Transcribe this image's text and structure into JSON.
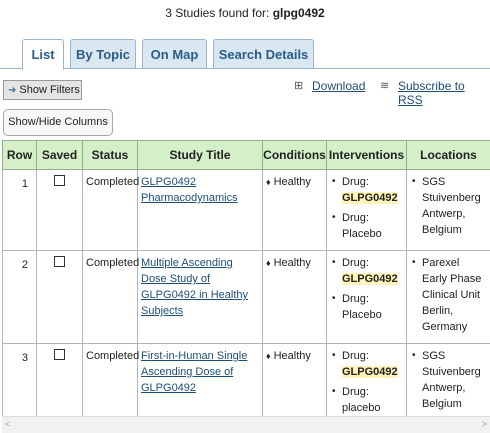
{
  "header": {
    "prefix": "3 Studies found for: ",
    "query": "glpg0492"
  },
  "tabs": [
    {
      "label": "List"
    },
    {
      "label": "By Topic"
    },
    {
      "label": "On Map"
    },
    {
      "label": "Search Details"
    }
  ],
  "toolbar": {
    "show_filters": "Show Filters",
    "download": "Download",
    "subscribe": "Subscribe to RSS",
    "show_hide_columns": "Show/Hide Columns"
  },
  "table": {
    "columns": [
      "Row",
      "Saved",
      "Status",
      "Study Title",
      "Conditions",
      "Interventions",
      "Locations"
    ],
    "rows": [
      {
        "row": "1",
        "status": "Completed",
        "title": "GLPG0492 Pharmacodynamics",
        "condition": "Healthy",
        "int1_type": "Drug:",
        "int1_name": "GLPG0492",
        "int2_type": "Drug:",
        "int2_name": "Placebo",
        "loc_name": "SGS Stuivenberg",
        "loc_city": "Antwerp,",
        "loc_country": "Belgium"
      },
      {
        "row": "2",
        "status": "Completed",
        "title_pre": "Multiple Ascending Dose Study of ",
        "title_hl": "GLPG0492",
        "title_post": " in Healthy Subjects",
        "condition": "Healthy",
        "int1_type": "Drug:",
        "int1_name": "GLPG0492",
        "int2_type": "Drug:",
        "int2_name": "Placebo",
        "loc_name": "Parexel Early Phase Clinical Unit",
        "loc_city": "Berlin,",
        "loc_country": "Germany"
      },
      {
        "row": "3",
        "status": "Completed",
        "title_pre": "First-in-Human Single Ascending Dose of ",
        "title_hl": "GLPG0492",
        "condition": "Healthy",
        "int1_type": "Drug:",
        "int1_name": "GLPG0492",
        "int2_type": "Drug:",
        "int2_name": "placebo",
        "loc_name": "SGS Stuivenberg",
        "loc_city": "Antwerp,",
        "loc_country": "Belgium"
      }
    ]
  }
}
